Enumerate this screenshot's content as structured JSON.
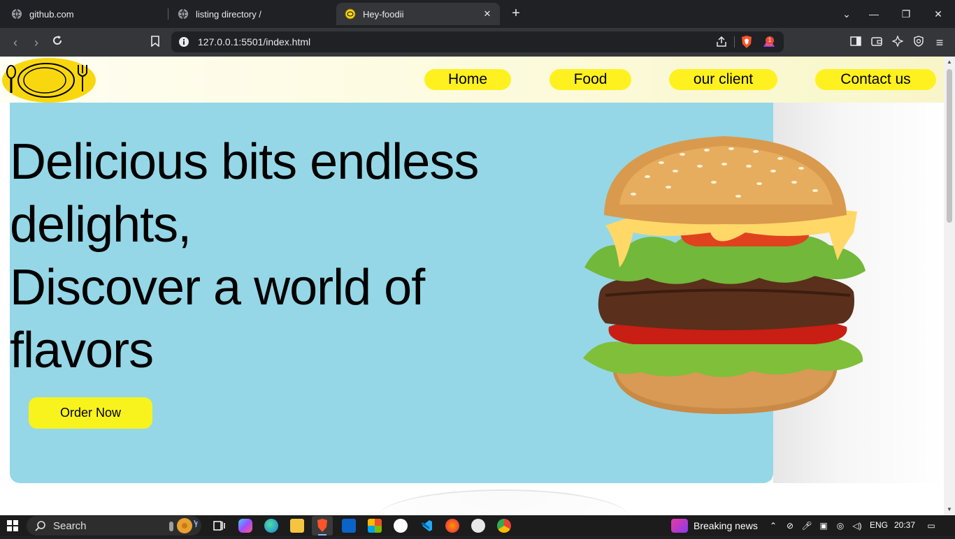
{
  "browser": {
    "tabs": [
      {
        "title": "github.com",
        "icon": "globe-icon",
        "active": false
      },
      {
        "title": "listing directory /",
        "icon": "globe-icon",
        "active": false
      },
      {
        "title": "Hey-foodii",
        "icon": "site-favicon",
        "active": true
      }
    ],
    "address": "127.0.0.1:5501/index.html",
    "rewards_badge": "1"
  },
  "page": {
    "nav": [
      "Home",
      "Food",
      "our client",
      "Contact us"
    ],
    "headline_lines": [
      "Delicious bits endless",
      "delights,",
      "Discover a world of",
      "flavors"
    ],
    "cta": "Order Now",
    "colors": {
      "hero_bg": "#95d7e7",
      "accent": "#fff11f",
      "text": "#000000"
    }
  },
  "taskbar": {
    "search_label": "Search",
    "news_label": "Breaking news",
    "language": "ENG",
    "time": "20:37"
  }
}
